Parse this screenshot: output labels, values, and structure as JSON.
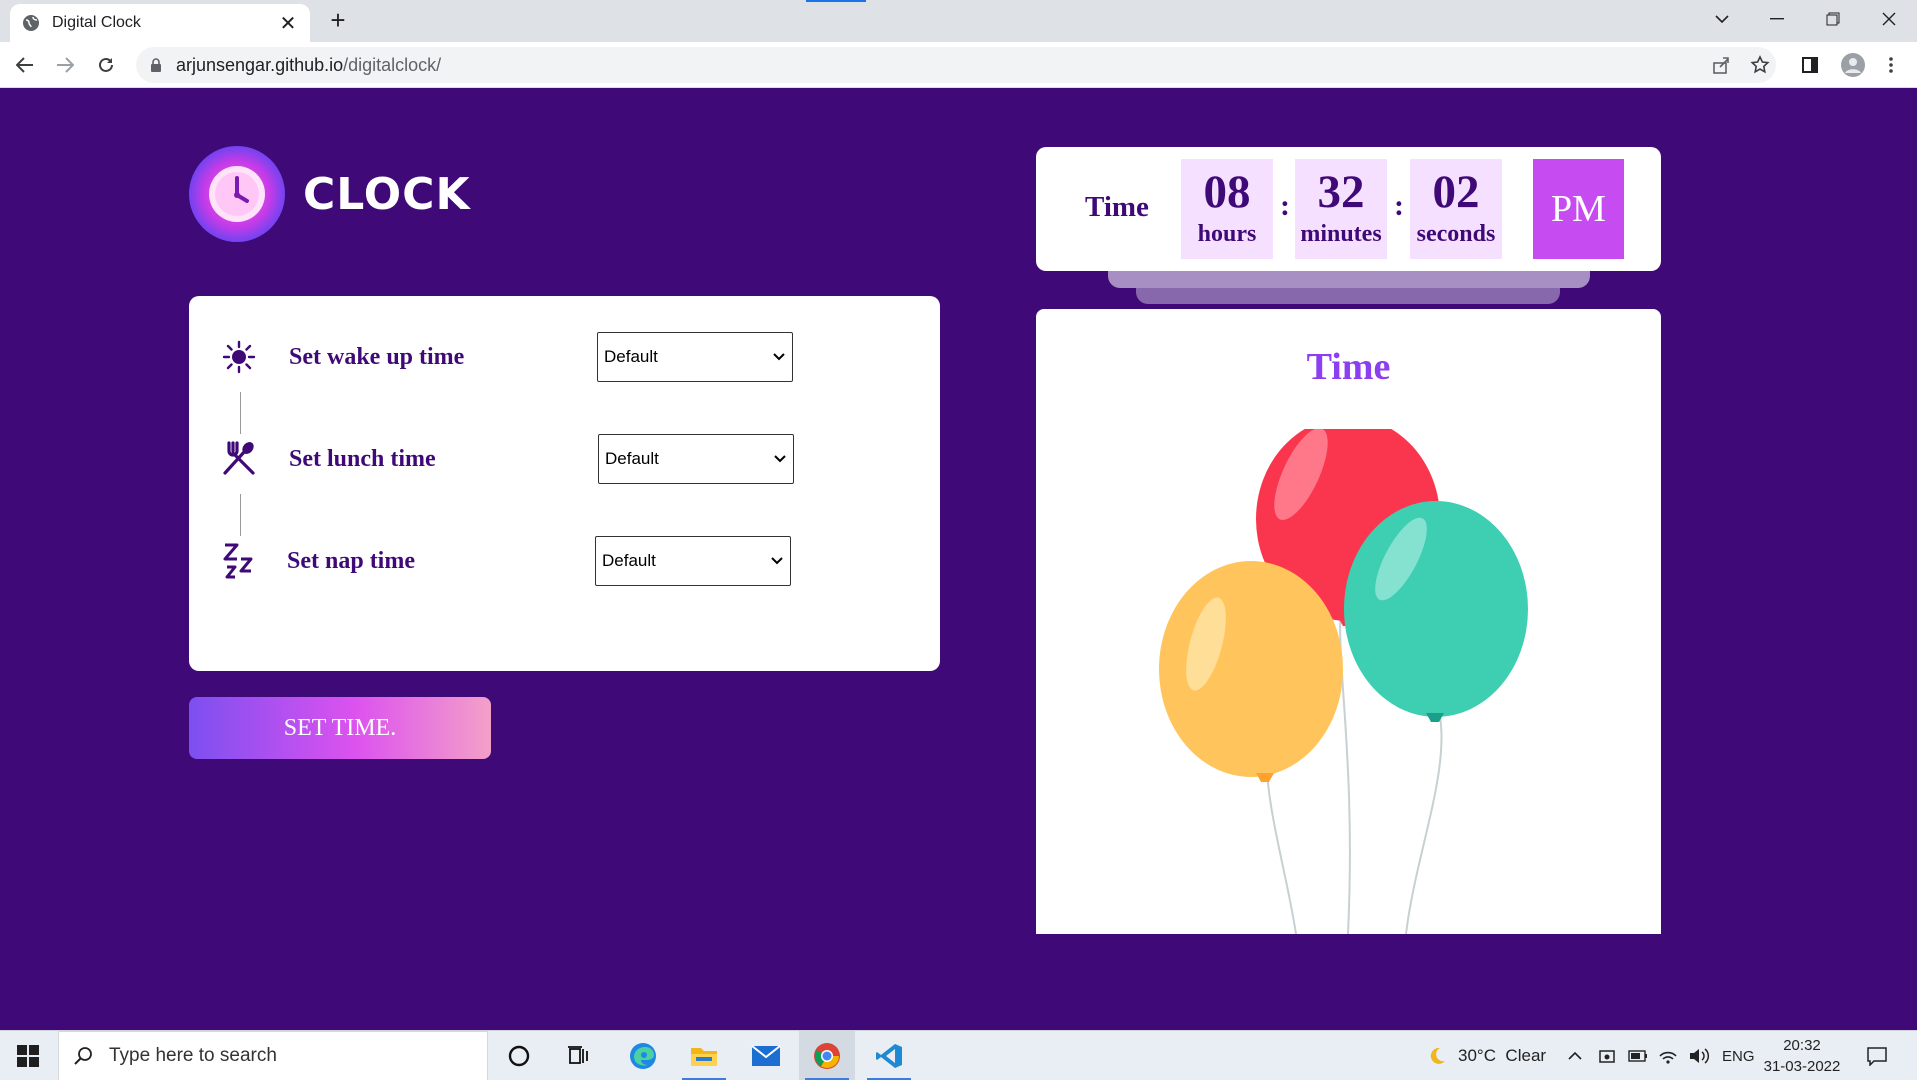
{
  "browser": {
    "tab_title": "Digital Clock",
    "url_host": "arjunsengar.github.io",
    "url_path": "/digitalclock/"
  },
  "page": {
    "logo_text": "CLOCK",
    "alarms": [
      {
        "label": "Set wake up time",
        "icon": "sun-icon",
        "value": "Default"
      },
      {
        "label": "Set lunch time",
        "icon": "fork-spoon-icon",
        "value": "Default"
      },
      {
        "label": "Set nap time",
        "icon": "zzz-icon",
        "value": "Default"
      }
    ],
    "set_button": "SET TIME.",
    "clock": {
      "label": "Time",
      "hours": "08",
      "hours_unit": "hours",
      "minutes": "32",
      "minutes_unit": "minutes",
      "seconds": "02",
      "seconds_unit": "seconds",
      "separator": ":",
      "ampm": "PM"
    },
    "image_card_title": "Time",
    "colors": {
      "background": "#3f0a77",
      "accent": "#c64bf0",
      "unit_bg": "#f5e1ff"
    }
  },
  "taskbar": {
    "search_placeholder": "Type here to search",
    "weather": "30°C  Clear",
    "language": "ENG",
    "time": "20:32",
    "date": "31-03-2022"
  }
}
